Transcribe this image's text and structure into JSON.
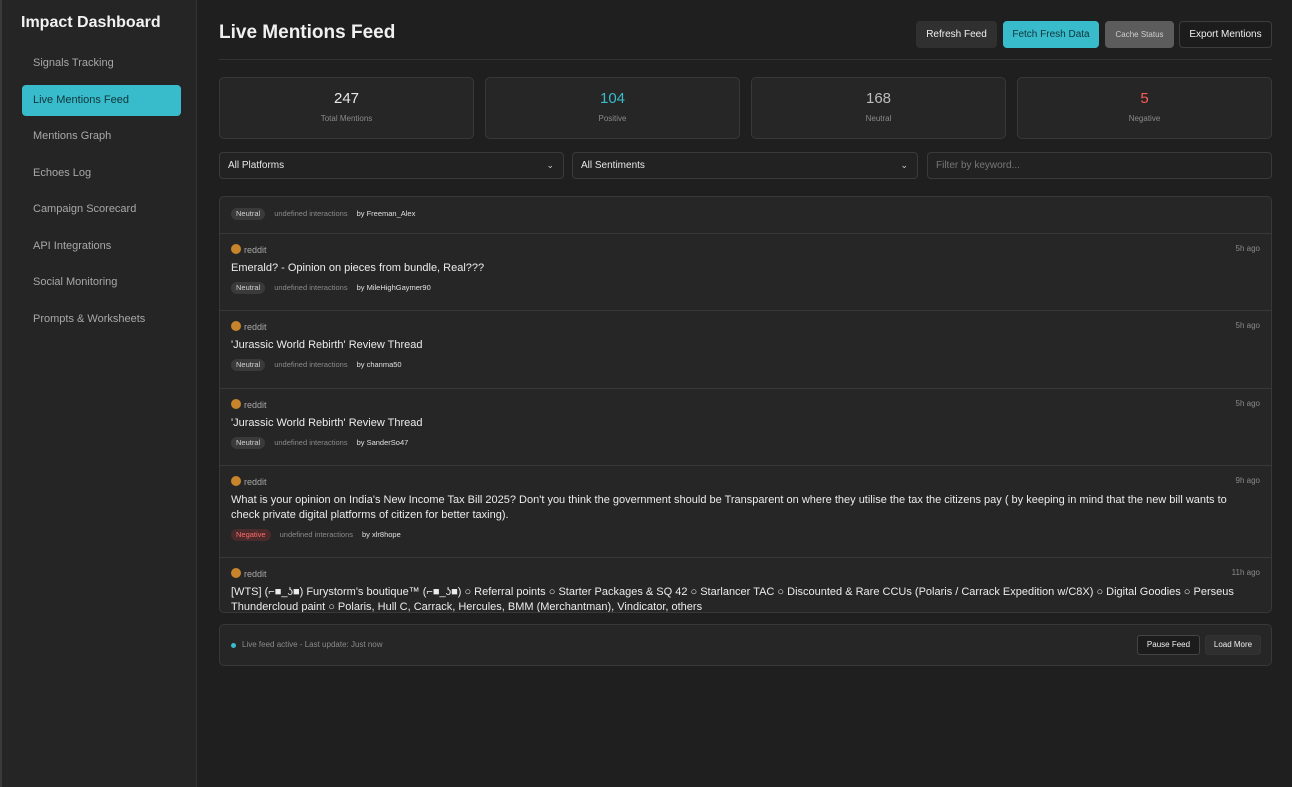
{
  "sidebar": {
    "brand": "Impact Dashboard",
    "items": [
      {
        "label": "Signals Tracking"
      },
      {
        "label": "Live Mentions Feed"
      },
      {
        "label": "Mentions Graph"
      },
      {
        "label": "Echoes Log"
      },
      {
        "label": "Campaign Scorecard"
      },
      {
        "label": "API Integrations"
      },
      {
        "label": "Social Monitoring"
      },
      {
        "label": "Prompts & Worksheets"
      }
    ],
    "active_index": 1
  },
  "header": {
    "title": "Live Mentions Feed",
    "buttons": {
      "refresh": "Refresh Feed",
      "fetch": "Fetch Fresh Data",
      "cache": "Cache Status",
      "export": "Export Mentions"
    }
  },
  "stats": [
    {
      "value": "247",
      "label": "Total Mentions",
      "color": "#e8e8e8"
    },
    {
      "value": "104",
      "label": "Positive",
      "color": "#38bccb"
    },
    {
      "value": "168",
      "label": "Neutral",
      "color": "#bdbdbd"
    },
    {
      "value": "5",
      "label": "Negative",
      "color": "#ff5a5a"
    }
  ],
  "filters": {
    "platform": "All Platforms",
    "sentiment": "All Sentiments",
    "keyword_placeholder": "Filter by keyword..."
  },
  "feed": [
    {
      "platform": "",
      "time": "",
      "title": "",
      "sentiment": "Neutral",
      "interactions": "undefined interactions",
      "author": "by Freeman_Alex"
    },
    {
      "platform": "reddit",
      "time": "5h ago",
      "title": "Emerald? - Opinion on pieces from bundle, Real???",
      "sentiment": "Neutral",
      "interactions": "undefined interactions",
      "author": "by MileHighGaymer90"
    },
    {
      "platform": "reddit",
      "time": "5h ago",
      "title": "'Jurassic World Rebirth' Review Thread",
      "sentiment": "Neutral",
      "interactions": "undefined interactions",
      "author": "by chanma50"
    },
    {
      "platform": "reddit",
      "time": "5h ago",
      "title": "'Jurassic World Rebirth' Review Thread",
      "sentiment": "Neutral",
      "interactions": "undefined interactions",
      "author": "by SanderSo47"
    },
    {
      "platform": "reddit",
      "time": "9h ago",
      "title": "What is your opinion on India's New Income Tax Bill 2025? Don't you think the government should be Transparent on where they utilise the tax the citizens pay ( by keeping in mind that the new bill wants to check private digital platforms of citizen for better taxing).",
      "sentiment": "Negative",
      "interactions": "undefined interactions",
      "author": "by xlr8hope"
    },
    {
      "platform": "reddit",
      "time": "11h ago",
      "title": "[WTS] (⌐■_ʖ■) Furystorm's boutique™ (⌐■_ʖ■) ○ Referral points ○ Starter Packages & SQ 42 ○ Starlancer TAC ○ Discounted & Rare CCUs (Polaris / Carrack Expedition w/C8X) ○ Digital Goodies ○ Perseus Thundercloud paint ○ Polaris, Hull C, Carrack, Hercules, BMM (Merchantman), Vindicator, others",
      "sentiment": "",
      "interactions": "",
      "author": ""
    }
  ],
  "footer": {
    "status": "Live feed active - Last update: Just now",
    "pause": "Pause Feed",
    "load_more": "Load More"
  }
}
